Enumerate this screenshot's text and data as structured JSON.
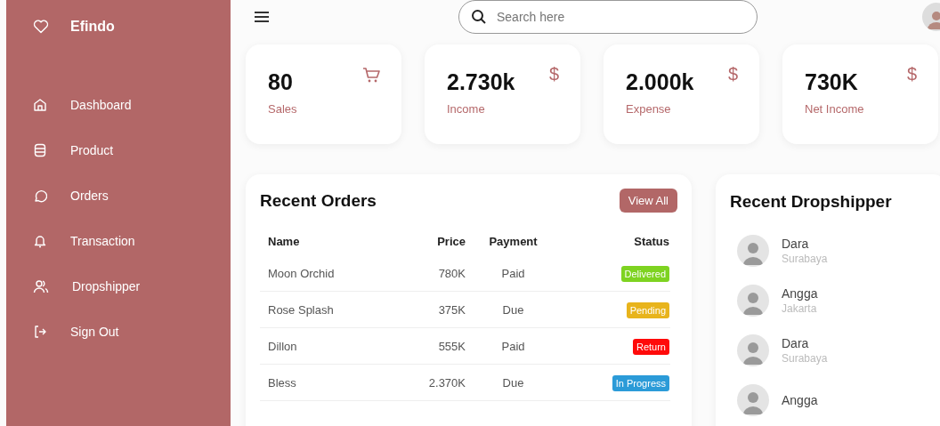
{
  "brand": {
    "name": "Efindo"
  },
  "nav": [
    {
      "label": "Dashboard"
    },
    {
      "label": "Product"
    },
    {
      "label": "Orders"
    },
    {
      "label": "Transaction"
    },
    {
      "label": "Dropshipper"
    },
    {
      "label": "Sign Out"
    }
  ],
  "search": {
    "placeholder": "Search here"
  },
  "stats": [
    {
      "value": "80",
      "label": "Sales",
      "kind": "count"
    },
    {
      "value": "2.730k",
      "label": "Income",
      "kind": "money",
      "symbol": "$"
    },
    {
      "value": "2.000k",
      "label": "Expense",
      "kind": "money",
      "symbol": "$"
    },
    {
      "value": "730K",
      "label": "Net Income",
      "kind": "money",
      "symbol": "$"
    }
  ],
  "recent_orders": {
    "title": "Recent Orders",
    "button": "View All",
    "columns": [
      "Name",
      "Price",
      "Payment",
      "Status"
    ],
    "rows": [
      {
        "name": "Moon Orchid",
        "price": "780K",
        "payment": "Paid",
        "status": "Delivered",
        "color": "#7ed321"
      },
      {
        "name": "Rose Splash",
        "price": "375K",
        "payment": "Due",
        "status": "Pending",
        "color": "#e8b41c"
      },
      {
        "name": "Dillon",
        "price": "555K",
        "payment": "Paid",
        "status": "Return",
        "color": "#ff0a0a"
      },
      {
        "name": "Bless",
        "price": "2.370K",
        "payment": "Due",
        "status": "In Progress",
        "color": "#2b9bd8"
      }
    ]
  },
  "recent_dropshipper": {
    "title": "Recent Dropshipper",
    "items": [
      {
        "name": "Dara",
        "city": "Surabaya"
      },
      {
        "name": "Angga",
        "city": "Jakarta"
      },
      {
        "name": "Dara",
        "city": "Surabaya"
      },
      {
        "name": "Angga"
      }
    ]
  }
}
